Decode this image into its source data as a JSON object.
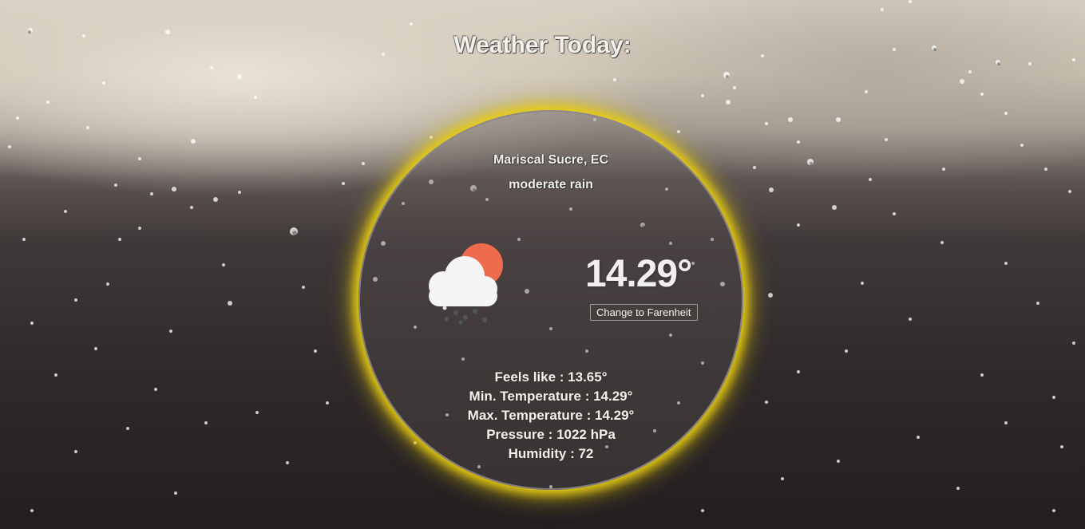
{
  "page": {
    "title": "Weather Today:"
  },
  "weather": {
    "location": "Mariscal Sucre, EC",
    "description": "moderate rain",
    "temperature": "14.29°",
    "icon": "cloud-sun-rain-icon",
    "toggle_label": "Change to Farenheit"
  },
  "stats": {
    "feels_like": "Feels like : 13.65°",
    "min_temp": "Min. Temperature : 14.29°",
    "max_temp": "Max. Temperature : 14.29°",
    "pressure": "Pressure : 1022 hPa",
    "humidity": "Humidity : 72"
  },
  "colors": {
    "glow": "#e8cd14",
    "sun": "#ee6b4d",
    "cloud": "#f5f5f5"
  }
}
